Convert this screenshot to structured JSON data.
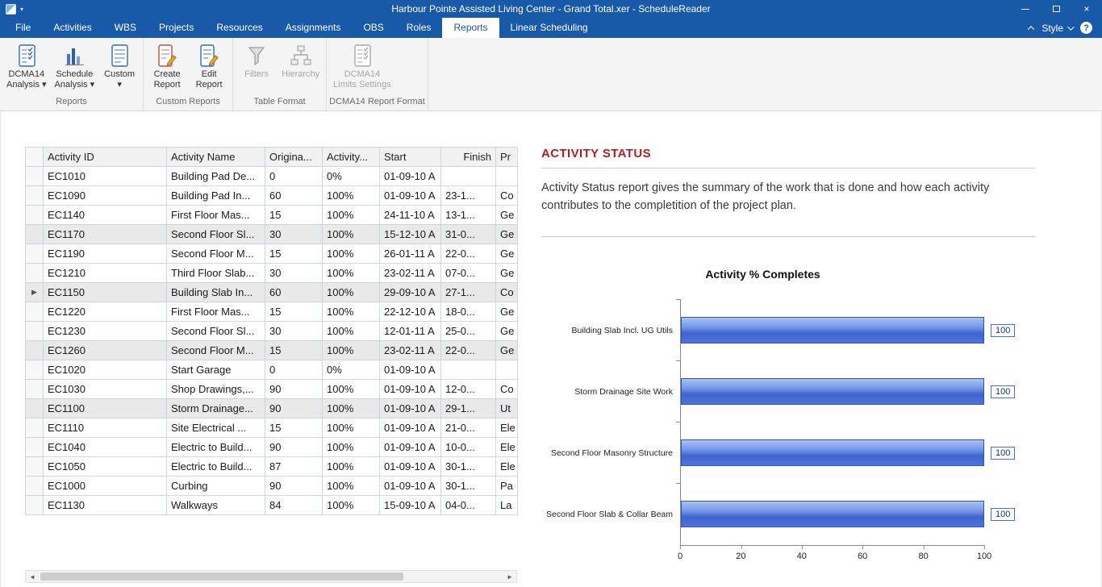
{
  "colors": {
    "accent": "#1859a8",
    "heading_red": "#b01e23",
    "bar_blue": "#4a70d8"
  },
  "window": {
    "title": "Harbour Pointe Assisted Living Center - Grand Total.xer - ScheduleReader"
  },
  "menu": {
    "tabs": [
      {
        "label": "File",
        "active": false
      },
      {
        "label": "Activities",
        "active": false
      },
      {
        "label": "WBS",
        "active": false
      },
      {
        "label": "Projects",
        "active": false
      },
      {
        "label": "Resources",
        "active": false
      },
      {
        "label": "Assignments",
        "active": false
      },
      {
        "label": "OBS",
        "active": false
      },
      {
        "label": "Roles",
        "active": false
      },
      {
        "label": "Reports",
        "active": true
      },
      {
        "label": "Linear Scheduling",
        "active": false
      }
    ],
    "style_label": "Style",
    "help_label": "?"
  },
  "ribbon": {
    "groups": [
      {
        "label": "Reports",
        "buttons": [
          {
            "line1": "DCMA14",
            "line2": "Analysis",
            "dropdown": true,
            "icon": "checklist-icon",
            "disabled": false
          },
          {
            "line1": "Schedule",
            "line2": "Analysis",
            "dropdown": true,
            "icon": "barchart-icon",
            "disabled": false
          },
          {
            "line1": "Custom",
            "line2": "",
            "dropdown": true,
            "icon": "custom-report-icon",
            "disabled": false
          }
        ]
      },
      {
        "label": "Custom Reports",
        "buttons": [
          {
            "line1": "Create",
            "line2": "Report",
            "dropdown": false,
            "icon": "create-report-icon",
            "disabled": false
          },
          {
            "line1": "Edit",
            "line2": "Report",
            "dropdown": false,
            "icon": "edit-report-icon",
            "disabled": false
          }
        ]
      },
      {
        "label": "Table Format",
        "buttons": [
          {
            "line1": "Filters",
            "line2": "",
            "dropdown": false,
            "icon": "filter-icon",
            "disabled": true
          },
          {
            "line1": "Hierarchy",
            "line2": "",
            "dropdown": false,
            "icon": "hierarchy-icon",
            "disabled": true
          }
        ]
      },
      {
        "label": "DCMA14 Report Format",
        "buttons": [
          {
            "line1": "DCMA14",
            "line2": "Limits Settings",
            "dropdown": false,
            "icon": "settings-checklist-icon",
            "disabled": true
          }
        ]
      }
    ]
  },
  "table": {
    "columns": [
      "Activity ID",
      "Activity Name",
      "Origina...",
      "Activity...",
      "Start",
      "Finish",
      "Pr"
    ],
    "rows": [
      {
        "id": "EC1010",
        "name": "Building Pad De...",
        "orig": "0",
        "pct": "0%",
        "start": "01-09-10 A",
        "finish": "",
        "pr": "",
        "shaded": false,
        "current": false
      },
      {
        "id": "EC1090",
        "name": "Building Pad In...",
        "orig": "60",
        "pct": "100%",
        "start": "01-09-10 A",
        "finish": "23-1...",
        "pr": "Co",
        "shaded": false,
        "current": false
      },
      {
        "id": "EC1140",
        "name": "First Floor Mas...",
        "orig": "15",
        "pct": "100%",
        "start": "24-11-10 A",
        "finish": "13-1...",
        "pr": "Ge",
        "shaded": false,
        "current": false
      },
      {
        "id": "EC1170",
        "name": "Second Floor Sl...",
        "orig": "30",
        "pct": "100%",
        "start": "15-12-10 A",
        "finish": "31-0...",
        "pr": "Ge",
        "shaded": true,
        "current": false
      },
      {
        "id": "EC1190",
        "name": "Second Floor M...",
        "orig": "15",
        "pct": "100%",
        "start": "26-01-11 A",
        "finish": "22-0...",
        "pr": "Ge",
        "shaded": false,
        "current": false
      },
      {
        "id": "EC1210",
        "name": "Third Floor Slab...",
        "orig": "30",
        "pct": "100%",
        "start": "23-02-11 A",
        "finish": "07-0...",
        "pr": "Ge",
        "shaded": false,
        "current": false
      },
      {
        "id": "EC1150",
        "name": "Building Slab In...",
        "orig": "60",
        "pct": "100%",
        "start": "29-09-10 A",
        "finish": "27-1...",
        "pr": "Co",
        "shaded": true,
        "current": true
      },
      {
        "id": "EC1220",
        "name": "First Floor Mas...",
        "orig": "15",
        "pct": "100%",
        "start": "22-12-10 A",
        "finish": "18-0...",
        "pr": "Ge",
        "shaded": false,
        "current": false
      },
      {
        "id": "EC1230",
        "name": "Second Floor Sl...",
        "orig": "30",
        "pct": "100%",
        "start": "12-01-11 A",
        "finish": "25-0...",
        "pr": "Ge",
        "shaded": false,
        "current": false
      },
      {
        "id": "EC1260",
        "name": "Second Floor M...",
        "orig": "15",
        "pct": "100%",
        "start": "23-02-11 A",
        "finish": "22-0...",
        "pr": "Ge",
        "shaded": true,
        "current": false
      },
      {
        "id": "EC1020",
        "name": "Start Garage",
        "orig": "0",
        "pct": "0%",
        "start": "01-09-10 A",
        "finish": "",
        "pr": "",
        "shaded": false,
        "current": false
      },
      {
        "id": "EC1030",
        "name": "Shop Drawings,...",
        "orig": "90",
        "pct": "100%",
        "start": "01-09-10 A",
        "finish": "12-0...",
        "pr": "Co",
        "shaded": false,
        "current": false
      },
      {
        "id": "EC1100",
        "name": "Storm Drainage...",
        "orig": "90",
        "pct": "100%",
        "start": "01-09-10 A",
        "finish": "29-1...",
        "pr": "Ut",
        "shaded": true,
        "current": false
      },
      {
        "id": "EC1110",
        "name": "Site Electrical ...",
        "orig": "15",
        "pct": "100%",
        "start": "01-09-10 A",
        "finish": "21-0...",
        "pr": "Ele",
        "shaded": false,
        "current": false
      },
      {
        "id": "EC1040",
        "name": "Electric to Build...",
        "orig": "90",
        "pct": "100%",
        "start": "01-09-10 A",
        "finish": "10-0...",
        "pr": "Ele",
        "shaded": false,
        "current": false
      },
      {
        "id": "EC1050",
        "name": "Electric to Build...",
        "orig": "87",
        "pct": "100%",
        "start": "01-09-10 A",
        "finish": "30-1...",
        "pr": "Ele",
        "shaded": false,
        "current": false
      },
      {
        "id": "EC1000",
        "name": "Curbing",
        "orig": "90",
        "pct": "100%",
        "start": "01-09-10 A",
        "finish": "30-1...",
        "pr": "Pa",
        "shaded": false,
        "current": false
      },
      {
        "id": "EC1130",
        "name": "Walkways",
        "orig": "84",
        "pct": "100%",
        "start": "15-09-10 A",
        "finish": "04-0...",
        "pr": "La",
        "shaded": false,
        "current": false
      }
    ]
  },
  "report": {
    "title": "ACTIVITY STATUS",
    "description": "Activity Status report gives the summary of the work that is done and how each activity contributes to the completition of the project plan."
  },
  "chart_data": {
    "type": "bar",
    "orientation": "horizontal",
    "title": "Activity % Completes",
    "categories": [
      "Building Slab Incl. UG Utils",
      "Storm Drainage Site Work",
      "Second Floor Masonry Structure",
      "Second Floor Slab & Collar Beam"
    ],
    "values": [
      100,
      100,
      100,
      100
    ],
    "xlabel": "",
    "ylabel": "",
    "xlim": [
      0,
      100
    ],
    "xticks": [
      0,
      20,
      40,
      60,
      80,
      100
    ],
    "grid": false,
    "legend": "none"
  }
}
